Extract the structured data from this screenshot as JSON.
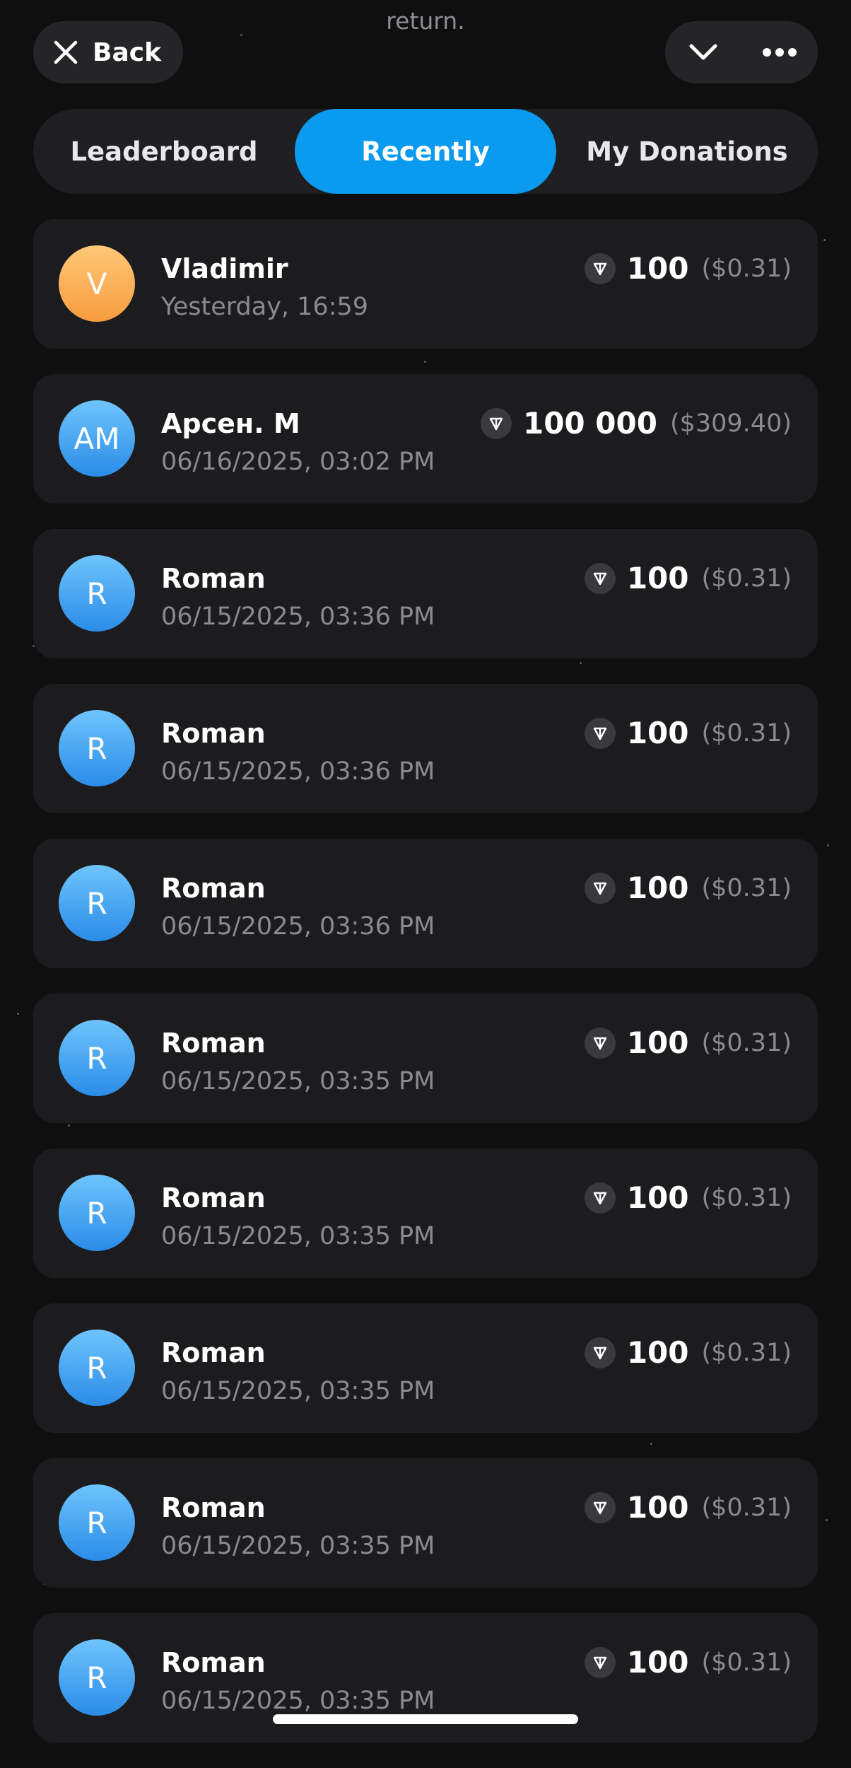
{
  "header": {
    "top_text": "return.",
    "back_label": "Back"
  },
  "tabs": [
    {
      "label": "Leaderboard",
      "active": false
    },
    {
      "label": "Recently",
      "active": true
    },
    {
      "label": "My Donations",
      "active": false
    }
  ],
  "donations": [
    {
      "initials": "V",
      "name": "Vladimir",
      "date": "Yesterday, 16:59",
      "amount": "100",
      "usd": "($0.31)",
      "color": "orange"
    },
    {
      "initials": "AM",
      "name": "Арсен. М",
      "date": "06/16/2025, 03:02 PM",
      "amount": "100 000",
      "usd": "($309.40)",
      "color": "blue"
    },
    {
      "initials": "R",
      "name": "Roman",
      "date": "06/15/2025, 03:36 PM",
      "amount": "100",
      "usd": "($0.31)",
      "color": "blue"
    },
    {
      "initials": "R",
      "name": "Roman",
      "date": "06/15/2025, 03:36 PM",
      "amount": "100",
      "usd": "($0.31)",
      "color": "blue"
    },
    {
      "initials": "R",
      "name": "Roman",
      "date": "06/15/2025, 03:36 PM",
      "amount": "100",
      "usd": "($0.31)",
      "color": "blue"
    },
    {
      "initials": "R",
      "name": "Roman",
      "date": "06/15/2025, 03:35 PM",
      "amount": "100",
      "usd": "($0.31)",
      "color": "blue"
    },
    {
      "initials": "R",
      "name": "Roman",
      "date": "06/15/2025, 03:35 PM",
      "amount": "100",
      "usd": "($0.31)",
      "color": "blue"
    },
    {
      "initials": "R",
      "name": "Roman",
      "date": "06/15/2025, 03:35 PM",
      "amount": "100",
      "usd": "($0.31)",
      "color": "blue"
    },
    {
      "initials": "R",
      "name": "Roman",
      "date": "06/15/2025, 03:35 PM",
      "amount": "100",
      "usd": "($0.31)",
      "color": "blue"
    },
    {
      "initials": "R",
      "name": "Roman",
      "date": "06/15/2025, 03:35 PM",
      "amount": "100",
      "usd": "($0.31)",
      "color": "blue"
    }
  ],
  "icons": {
    "back": "close-icon",
    "collapse": "chevron-down-icon",
    "more": "more-icon",
    "currency": "ton-icon"
  },
  "colors": {
    "accent": "#0a9af0",
    "background": "#0f0f10",
    "card": "#1c1c1e",
    "avatar_orange": "#f7a14a",
    "avatar_blue": "#3a9ff0"
  }
}
